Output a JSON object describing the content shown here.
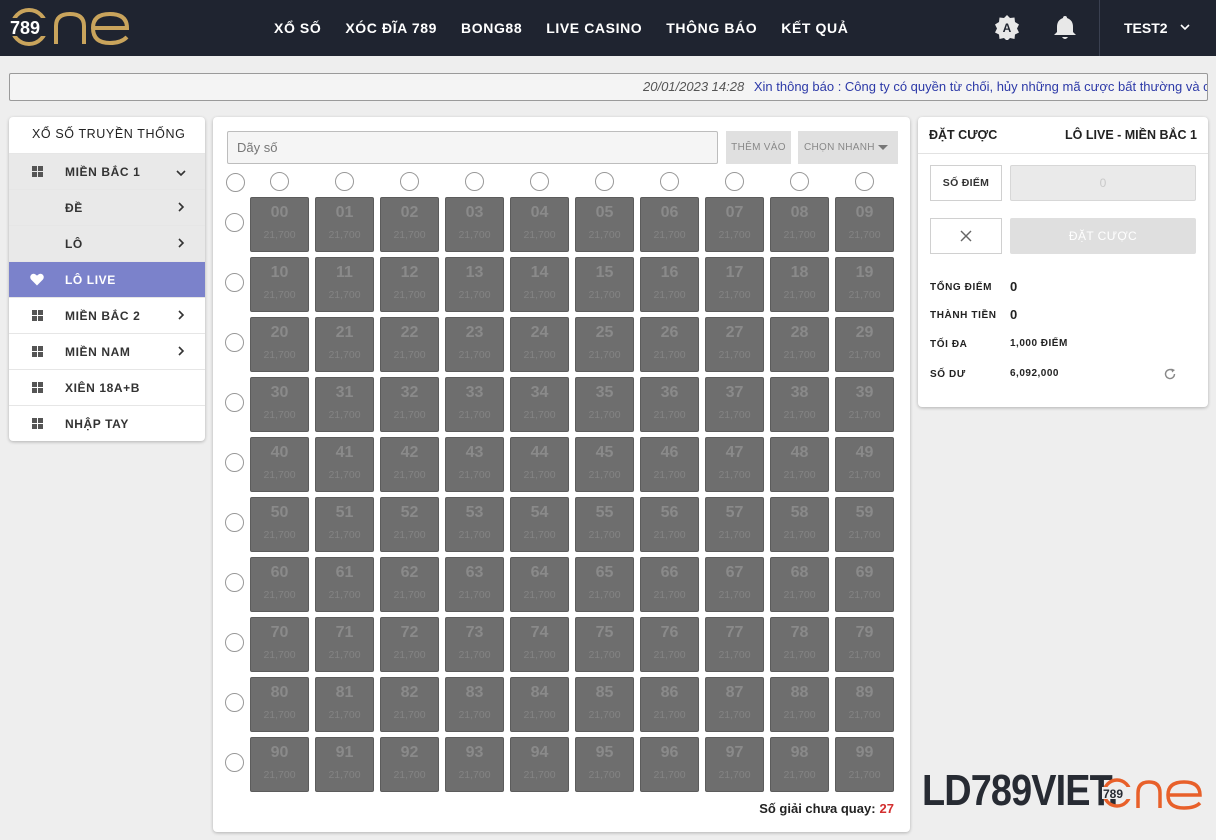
{
  "brand": {
    "logo_text": "789ONE",
    "accent": "#c9a45c",
    "topbar_bg": "#1f2430"
  },
  "nav": {
    "items": [
      "XỔ SỐ",
      "XÓC ĐĨA 789",
      "BONG88",
      "LIVE CASINO",
      "THÔNG BÁO",
      "KẾT QUẢ"
    ]
  },
  "user": {
    "name": "TEST2"
  },
  "notice": {
    "date": "20/01/2023 14:28",
    "message": "Xin thông báo : Công ty có quyền từ chối, hủy những mã cược bất thường và có"
  },
  "sidebar": {
    "title": "XỔ SỐ TRUYỀN THỐNG",
    "items": [
      {
        "label": "MIỀN BẮC 1",
        "icon": "grid-icon",
        "expanded": true
      },
      {
        "label": "ĐỀ",
        "sub": true
      },
      {
        "label": "LÔ",
        "sub": true
      },
      {
        "label": "LÔ LIVE",
        "icon": "heart-icon",
        "active": true
      },
      {
        "label": "MIỀN BẮC 2",
        "icon": "grid-icon"
      },
      {
        "label": "MIỀN NAM",
        "icon": "grid-icon"
      },
      {
        "label": "XIÊN 18A+B",
        "icon": "grid-icon"
      },
      {
        "label": "NHẬP TAY",
        "icon": "grid-icon"
      }
    ],
    "active_color": "#7b82cb"
  },
  "main": {
    "input_placeholder": "Dãy số",
    "add_button": "THÊM VÀO",
    "quick_button": "CHỌN NHANH",
    "odds": "21,700",
    "numbers": [
      "00",
      "01",
      "02",
      "03",
      "04",
      "05",
      "06",
      "07",
      "08",
      "09",
      "10",
      "11",
      "12",
      "13",
      "14",
      "15",
      "16",
      "17",
      "18",
      "19",
      "20",
      "21",
      "22",
      "23",
      "24",
      "25",
      "26",
      "27",
      "28",
      "29",
      "30",
      "31",
      "32",
      "33",
      "34",
      "35",
      "36",
      "37",
      "38",
      "39",
      "40",
      "41",
      "42",
      "43",
      "44",
      "45",
      "46",
      "47",
      "48",
      "49",
      "50",
      "51",
      "52",
      "53",
      "54",
      "55",
      "56",
      "57",
      "58",
      "59",
      "60",
      "61",
      "62",
      "63",
      "64",
      "65",
      "66",
      "67",
      "68",
      "69",
      "70",
      "71",
      "72",
      "73",
      "74",
      "75",
      "76",
      "77",
      "78",
      "79",
      "80",
      "81",
      "82",
      "83",
      "84",
      "85",
      "86",
      "87",
      "88",
      "89",
      "90",
      "91",
      "92",
      "93",
      "94",
      "95",
      "96",
      "97",
      "98",
      "99"
    ],
    "remaining_label": "Số giải chưa quay:",
    "remaining_count": "27",
    "remaining_color": "#d32f2f"
  },
  "bet": {
    "title": "ĐẶT CƯỢC",
    "subtitle": "LÔ LIVE - MIỀN BẮC 1",
    "points_label": "SỐ ĐIỂM",
    "points_value": "0",
    "submit_label": "ĐẶT CƯỢC",
    "total_label": "TỔNG ĐIỂM",
    "total_value": "0",
    "amount_label": "THÀNH TIỀN",
    "amount_value": "0",
    "max_label": "TỐI ĐA",
    "max_value": "1,000 ĐIỂM",
    "balance_label": "SỐ DƯ",
    "balance_value": "6,092,000"
  },
  "watermark": {
    "text": "LD789VIET.",
    "suffix": "789ONE"
  }
}
